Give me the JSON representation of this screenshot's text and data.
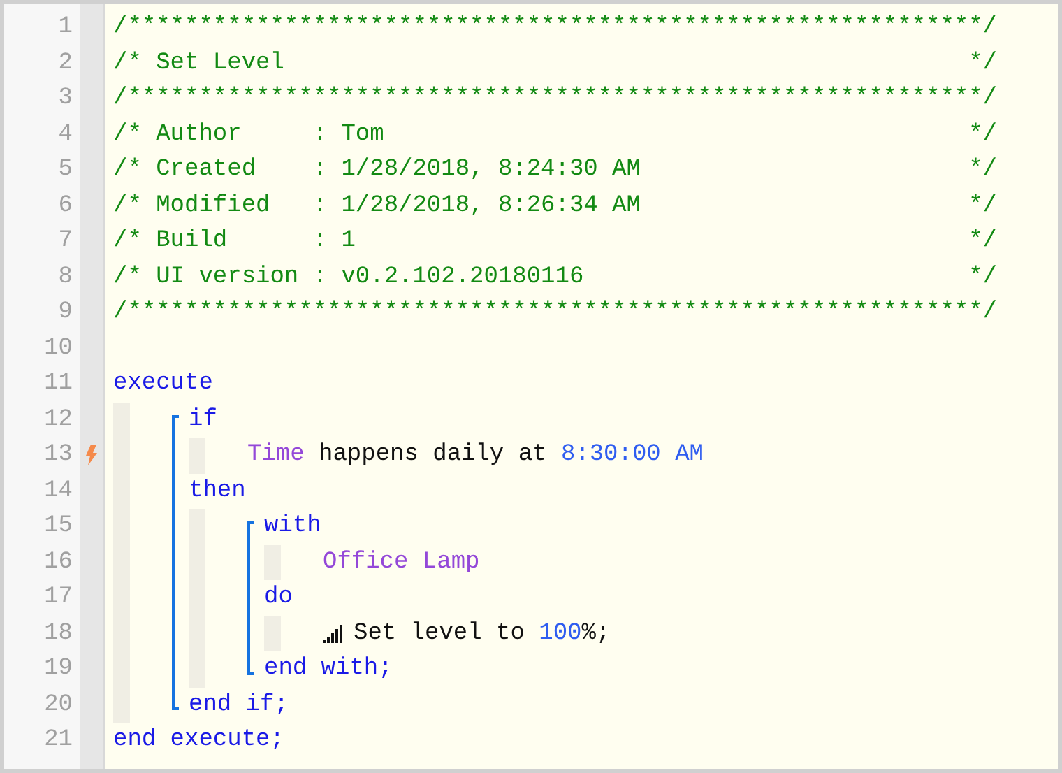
{
  "line_numbers": [
    "1",
    "2",
    "3",
    "4",
    "5",
    "6",
    "7",
    "8",
    "9",
    "10",
    "11",
    "12",
    "13",
    "14",
    "15",
    "16",
    "17",
    "18",
    "19",
    "20",
    "21"
  ],
  "header": [
    {
      "kind": "rule",
      "text": "/************************************************************/"
    },
    {
      "kind": "field",
      "text": "/* Set Level",
      "close": "*/"
    },
    {
      "kind": "rule",
      "text": "/************************************************************/"
    },
    {
      "kind": "field",
      "text": "/* Author     : Tom",
      "close": "*/"
    },
    {
      "kind": "field",
      "text": "/* Created    : 1/28/2018, 8:24:30 AM",
      "close": "*/"
    },
    {
      "kind": "field",
      "text": "/* Modified   : 1/28/2018, 8:26:34 AM",
      "close": "*/"
    },
    {
      "kind": "field",
      "text": "/* Build      : 1",
      "close": "*/"
    },
    {
      "kind": "field",
      "text": "/* UI version : v0.2.102.20180116",
      "close": "*/"
    },
    {
      "kind": "rule",
      "text": "/************************************************************/"
    },
    {
      "kind": "blank"
    }
  ],
  "program": {
    "kind": "block",
    "bracket": false,
    "sections": [
      {
        "tokens": [
          {
            "text": "execute",
            "kind": "keyword"
          }
        ],
        "children": [
          {
            "kind": "block",
            "bracket": true,
            "sections": [
              {
                "tokens": [
                  {
                    "text": "if",
                    "kind": "keyword"
                  }
                ],
                "children": [
                  {
                    "kind": "trigger",
                    "tokens": [
                      {
                        "text": "Time",
                        "kind": "device"
                      },
                      {
                        "text": " happens daily at ",
                        "kind": "text"
                      },
                      {
                        "text": "8:30:00 AM",
                        "kind": "value"
                      }
                    ]
                  }
                ]
              },
              {
                "tokens": [
                  {
                    "text": "then",
                    "kind": "keyword"
                  }
                ],
                "children": [
                  {
                    "kind": "block",
                    "bracket": true,
                    "sections": [
                      {
                        "tokens": [
                          {
                            "text": "with",
                            "kind": "keyword"
                          }
                        ],
                        "children": [
                          {
                            "kind": "statement",
                            "tokens": [
                              {
                                "text": "Office Lamp",
                                "kind": "device"
                              }
                            ]
                          }
                        ]
                      },
                      {
                        "tokens": [
                          {
                            "text": "do",
                            "kind": "keyword"
                          }
                        ],
                        "children": [
                          {
                            "kind": "action",
                            "tokens": [
                              {
                                "text": "Set level to ",
                                "kind": "text"
                              },
                              {
                                "text": "100",
                                "kind": "value"
                              },
                              {
                                "text": "%;",
                                "kind": "text"
                              }
                            ]
                          }
                        ]
                      }
                    ],
                    "end": [
                      {
                        "text": "end with;",
                        "kind": "keyword"
                      }
                    ]
                  }
                ]
              }
            ],
            "end": [
              {
                "text": "end if;",
                "kind": "keyword"
              }
            ]
          }
        ]
      }
    ],
    "end": [
      {
        "text": "end execute;",
        "kind": "keyword"
      }
    ]
  }
}
